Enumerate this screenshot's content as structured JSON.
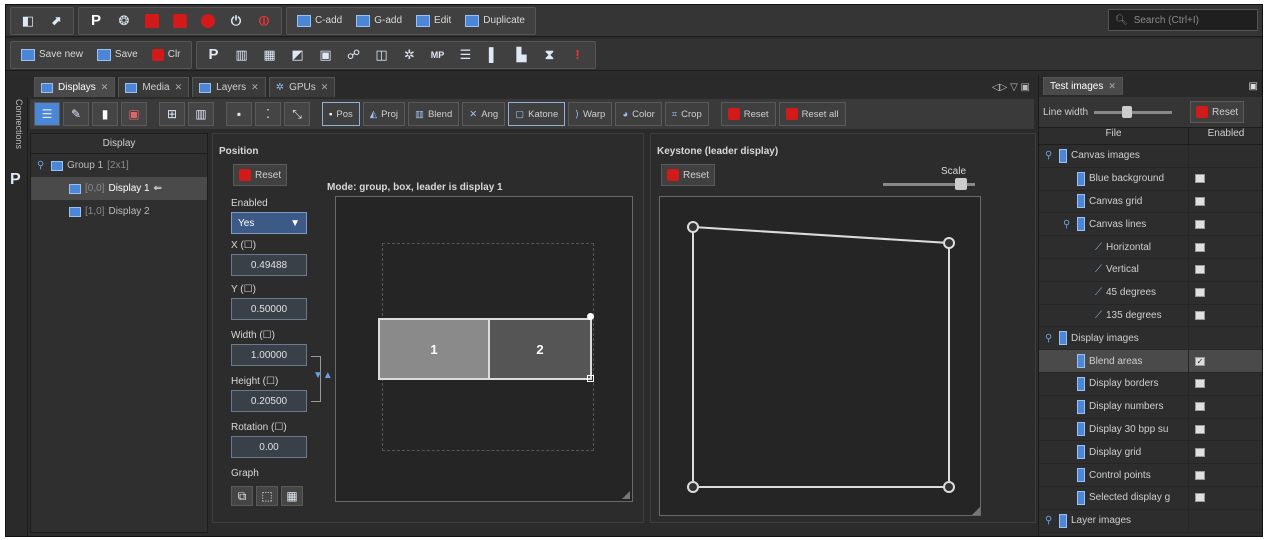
{
  "toolbar1": {
    "cadd": "C-add",
    "gadd": "G-add",
    "edit": "Edit",
    "duplicate": "Duplicate",
    "search_placeholder": "Search (Ctrl+I)"
  },
  "toolbar2": {
    "save_new": "Save new",
    "save": "Save",
    "clr": "Clr"
  },
  "tabs": [
    "Displays",
    "Media",
    "Layers",
    "GPUs"
  ],
  "side_label": "Connections",
  "display_toolbar": {
    "pos": "Pos",
    "proj": "Proj",
    "blend": "Blend",
    "ang": "Ang",
    "katone": "Katone",
    "warp": "Warp",
    "color": "Color",
    "crop": "Crop",
    "reset": "Reset",
    "reset_all": "Reset all"
  },
  "tree": {
    "header": "Display",
    "group_name": "Group 1",
    "group_dims": "[2x1]",
    "d1_index": "[0,0]",
    "d1_name": "Display 1",
    "d2_index": "[1,0]",
    "d2_name": "Display 2"
  },
  "position": {
    "title": "Position",
    "reset": "Reset",
    "mode_text": "Mode: group, box, leader is display 1",
    "enabled_label": "Enabled",
    "enabled_value": "Yes",
    "x_label": "X (☐)",
    "x_value": "0.49488",
    "y_label": "Y (☐)",
    "y_value": "0.50000",
    "w_label": "Width (☐)",
    "w_value": "1.00000",
    "h_label": "Height (☐)",
    "h_value": "0.20500",
    "r_label": "Rotation (☐)",
    "r_value": "0.00",
    "graph_label": "Graph",
    "box1": "1",
    "box2": "2"
  },
  "keystone": {
    "title": "Keystone (leader display)",
    "reset": "Reset",
    "scale": "Scale"
  },
  "right_panel": {
    "tab": "Test images",
    "line_width": "Line width",
    "reset": "Reset",
    "col_file": "File",
    "col_enabled": "Enabled",
    "rows": [
      {
        "label": "Canvas images"
      },
      {
        "label": "Blue background"
      },
      {
        "label": "Canvas grid"
      },
      {
        "label": "Canvas lines"
      },
      {
        "label": "Horizontal"
      },
      {
        "label": "Vertical"
      },
      {
        "label": "45 degrees"
      },
      {
        "label": "135 degrees"
      },
      {
        "label": "Display images"
      },
      {
        "label": "Blend areas"
      },
      {
        "label": "Display borders"
      },
      {
        "label": "Display numbers"
      },
      {
        "label": "Display 30 bpp su"
      },
      {
        "label": "Display grid"
      },
      {
        "label": "Control points"
      },
      {
        "label": "Selected display g"
      },
      {
        "label": "Layer images"
      }
    ]
  }
}
